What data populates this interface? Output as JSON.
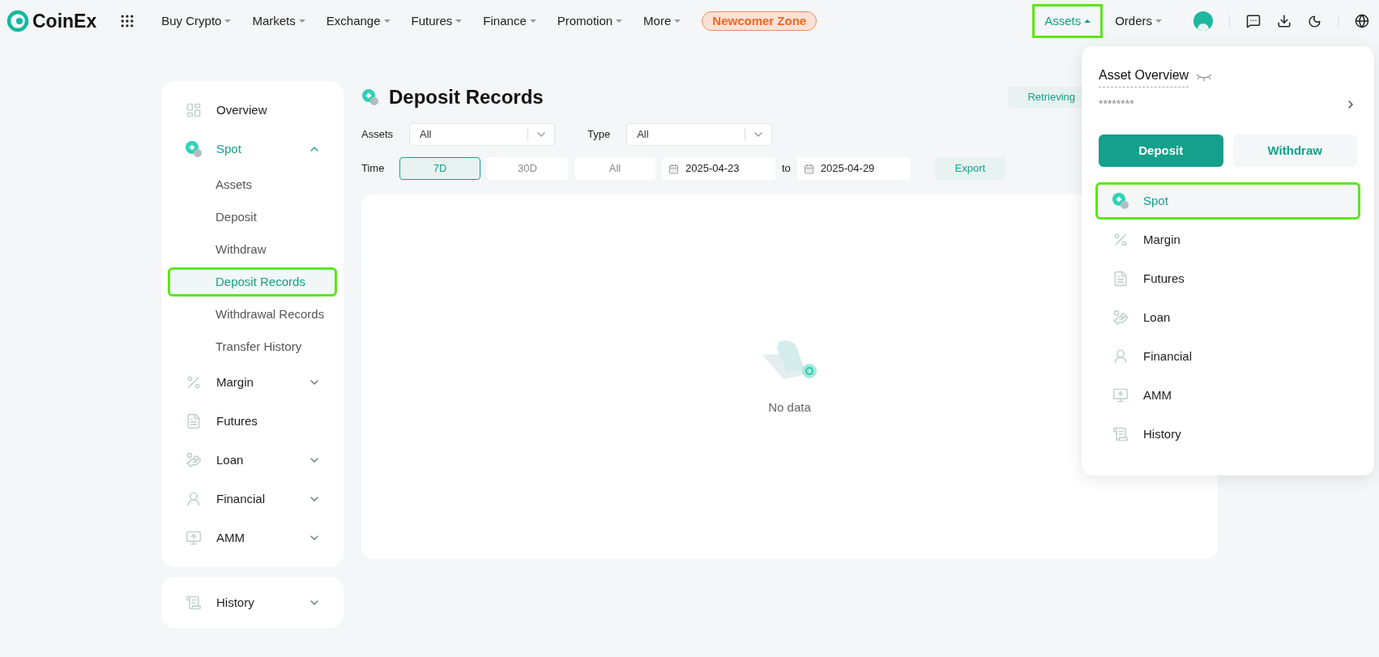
{
  "brand": {
    "name": "CoinEx"
  },
  "nav": [
    {
      "label": "Buy Crypto"
    },
    {
      "label": "Markets"
    },
    {
      "label": "Exchange"
    },
    {
      "label": "Futures"
    },
    {
      "label": "Finance"
    },
    {
      "label": "Promotion"
    },
    {
      "label": "More"
    }
  ],
  "promo_badge": "Newcomer Zone",
  "nav_right": [
    {
      "label": "Assets",
      "selected": true,
      "highlighted": true
    },
    {
      "label": "Orders",
      "selected": false,
      "highlighted": false
    }
  ],
  "sidebar": {
    "items": [
      {
        "label": "Overview",
        "kind": "link",
        "selected": false
      },
      {
        "label": "Spot",
        "kind": "group",
        "selected": true,
        "expanded": true,
        "children": [
          {
            "label": "Assets",
            "selected": false,
            "highlighted": false
          },
          {
            "label": "Deposit",
            "selected": false,
            "highlighted": false
          },
          {
            "label": "Withdraw",
            "selected": false,
            "highlighted": false
          },
          {
            "label": "Deposit Records",
            "selected": true,
            "highlighted": true
          },
          {
            "label": "Withdrawal Records",
            "selected": false,
            "highlighted": false
          },
          {
            "label": "Transfer History",
            "selected": false,
            "highlighted": false
          }
        ]
      },
      {
        "label": "Margin",
        "kind": "group",
        "selected": false,
        "expanded": false
      },
      {
        "label": "Futures",
        "kind": "link",
        "selected": false
      },
      {
        "label": "Loan",
        "kind": "group",
        "selected": false,
        "expanded": false
      },
      {
        "label": "Financial",
        "kind": "group",
        "selected": false,
        "expanded": false
      },
      {
        "label": "AMM",
        "kind": "group",
        "selected": false,
        "expanded": false
      }
    ],
    "footer_items": [
      {
        "label": "History",
        "kind": "group",
        "selected": false,
        "expanded": false
      }
    ]
  },
  "page": {
    "title": "Deposit Records",
    "retrieving_button": "Retrieving"
  },
  "filters": {
    "assets": {
      "label": "Assets",
      "value": "All"
    },
    "type": {
      "label": "Type",
      "value": "All"
    },
    "time": {
      "label": "Time",
      "options": [
        {
          "label": "7D",
          "selected": true
        },
        {
          "label": "30D",
          "selected": false
        },
        {
          "label": "All",
          "selected": false
        }
      ],
      "from": "2025-04-23",
      "separator": "to",
      "to": "2025-04-29"
    },
    "export_button": "Export"
  },
  "empty_state": "No data",
  "assets_menu": {
    "title": "Asset Overview",
    "balance": "********",
    "deposit_button": "Deposit",
    "withdraw_button": "Withdraw",
    "items": [
      {
        "label": "Spot",
        "selected": true,
        "highlighted": true
      },
      {
        "label": "Margin",
        "selected": false,
        "highlighted": false
      },
      {
        "label": "Futures",
        "selected": false,
        "highlighted": false
      },
      {
        "label": "Loan",
        "selected": false,
        "highlighted": false
      },
      {
        "label": "Financial",
        "selected": false,
        "highlighted": false
      },
      {
        "label": "AMM",
        "selected": false,
        "highlighted": false
      },
      {
        "label": "History",
        "selected": false,
        "highlighted": false
      }
    ]
  }
}
